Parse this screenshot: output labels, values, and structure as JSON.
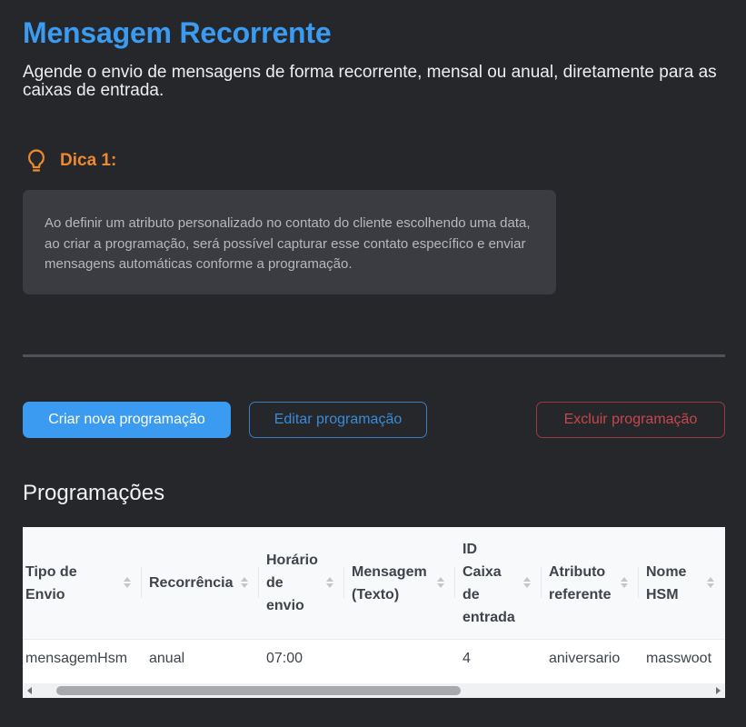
{
  "header": {
    "title": "Mensagem Recorrente",
    "subtitle": "Agende o envio de mensagens de forma recorrente, mensal ou anual, diretamente para as caixas de entrada."
  },
  "tip": {
    "icon": "lightbulb-icon",
    "label": "Dica 1:",
    "text": "Ao definir um atributo personalizado no contato do cliente escolhendo uma data, ao criar a programação, será possível capturar esse contato específico e enviar mensagens automáticas conforme a programação."
  },
  "actions": {
    "create_label": "Criar nova programação",
    "edit_label": "Editar programação",
    "delete_label": "Excluir programação"
  },
  "schedules": {
    "title": "Programações",
    "columns": [
      "Tipo de Envio",
      "Recorrência",
      "Horário de envio",
      "Mensagem (Texto)",
      "ID Caixa de entrada",
      "Atributo referente",
      "Nome HSM"
    ],
    "rows": [
      {
        "tipo_envio": "mensagemHsm",
        "recorrencia": "anual",
        "horario": "07:00",
        "mensagem": "",
        "id_caixa": "4",
        "atributo": "aniversario",
        "nome_hsm": "masswoot"
      }
    ]
  },
  "colors": {
    "background": "#26272b",
    "accent": "#3a9bf0",
    "tip": "#ee8a2d",
    "danger": "#c4484d"
  }
}
